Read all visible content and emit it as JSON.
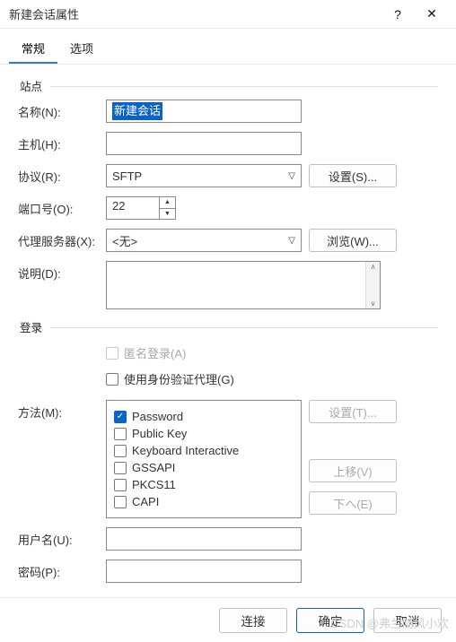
{
  "window": {
    "title": "新建会话属性",
    "help": "?",
    "close": "✕"
  },
  "tabs": {
    "general": "常规",
    "options": "选项"
  },
  "site": {
    "legend": "站点",
    "name_label": "名称(N):",
    "name_value": "新建会话",
    "host_label": "主机(H):",
    "host_value": "",
    "protocol_label": "协议(R):",
    "protocol_value": "SFTP",
    "settings_btn": "设置(S)...",
    "port_label": "端口号(O):",
    "port_value": "22",
    "proxy_label": "代理服务器(X):",
    "proxy_value": "<无>",
    "browse_btn": "浏览(W)...",
    "desc_label": "说明(D):"
  },
  "login": {
    "legend": "登录",
    "anonymous": "匿名登录(A)",
    "auth_agent": "使用身份验证代理(G)",
    "method_label": "方法(M):",
    "methods": [
      {
        "label": "Password",
        "checked": true
      },
      {
        "label": "Public Key",
        "checked": false
      },
      {
        "label": "Keyboard Interactive",
        "checked": false
      },
      {
        "label": "GSSAPI",
        "checked": false
      },
      {
        "label": "PKCS11",
        "checked": false
      },
      {
        "label": "CAPI",
        "checked": false
      }
    ],
    "method_settings": "设置(T)...",
    "move_up": "上移(V)",
    "move_down": "下へ(E)",
    "user_label": "用户名(U):",
    "user_value": "",
    "pass_label": "密码(P):",
    "pass_value": ""
  },
  "footer": {
    "connect": "连接",
    "ok": "确定",
    "cancel": "取消"
  },
  "watermark": "CSDN @弗兰随风小欢"
}
